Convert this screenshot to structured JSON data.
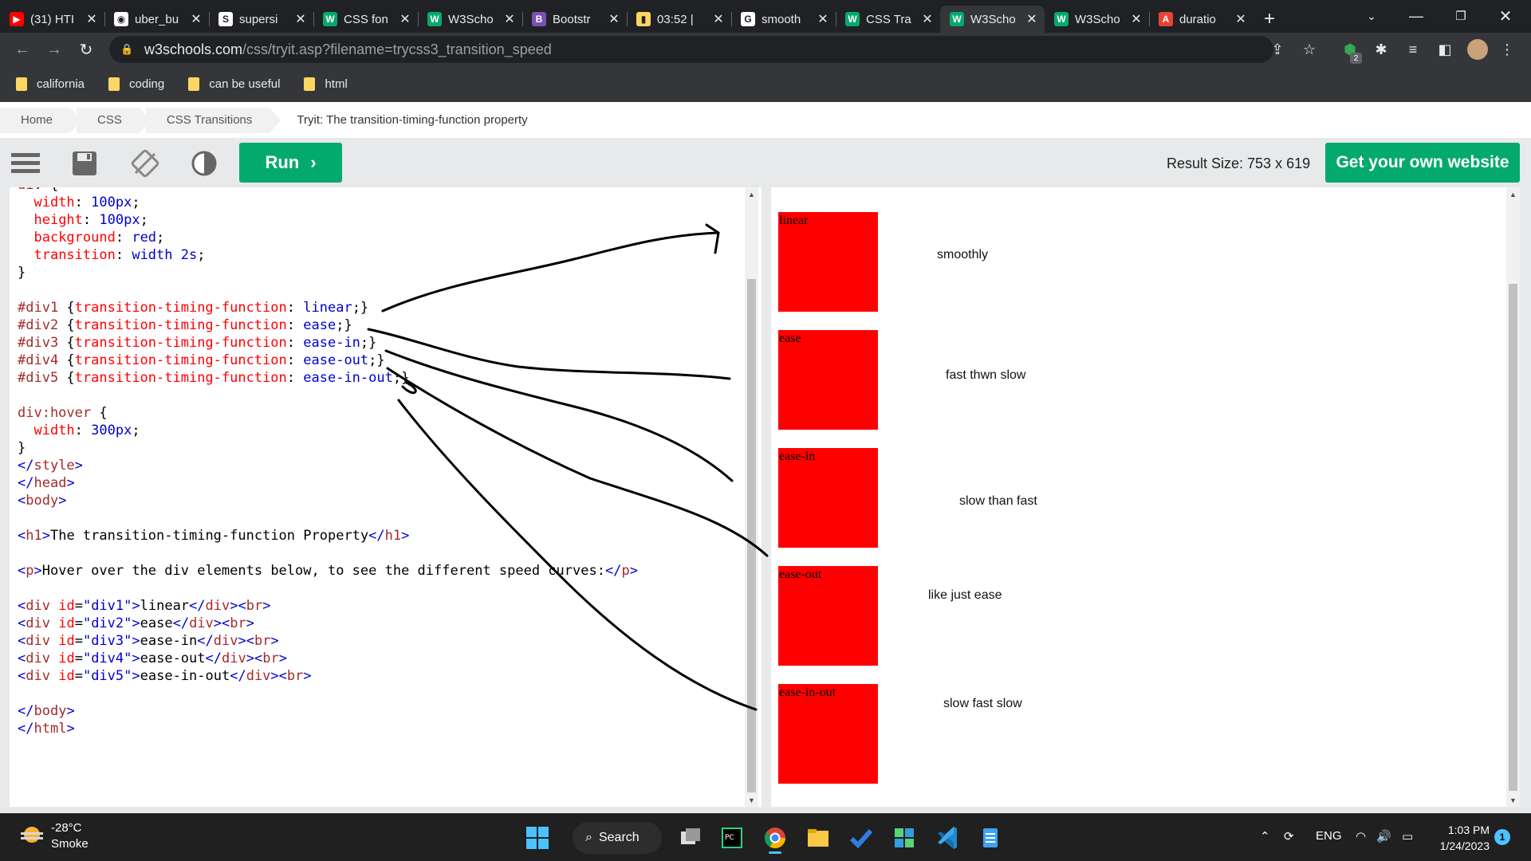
{
  "tabs": [
    {
      "title": "(31) HTI",
      "icon": "youtube-icon",
      "color": "#ff0000",
      "glyph": "▶"
    },
    {
      "title": "uber_bu",
      "icon": "github-icon",
      "color": "#ffffff",
      "glyph": "◉"
    },
    {
      "title": "supersi",
      "icon": "s-icon",
      "color": "#ffffff",
      "glyph": "S"
    },
    {
      "title": "CSS fon",
      "icon": "w3schools-icon",
      "color": "#04aa6d",
      "glyph": "W"
    },
    {
      "title": "W3Scho",
      "icon": "w3schools-icon",
      "color": "#04aa6d",
      "glyph": "W"
    },
    {
      "title": "Bootstr",
      "icon": "bootstrap-icon",
      "color": "#7952b3",
      "glyph": "B"
    },
    {
      "title": "03:52 |",
      "icon": "note-icon",
      "color": "#fcd663",
      "glyph": "▮"
    },
    {
      "title": "smooth",
      "icon": "google-icon",
      "color": "#ffffff",
      "glyph": "G"
    },
    {
      "title": "CSS Tra",
      "icon": "w3schools-icon",
      "color": "#04aa6d",
      "glyph": "W"
    },
    {
      "title": "W3Scho",
      "icon": "w3schools-icon",
      "color": "#04aa6d",
      "glyph": "W"
    },
    {
      "title": "W3Scho",
      "icon": "w3schools-icon",
      "color": "#04aa6d",
      "glyph": "W"
    },
    {
      "title": "duratio",
      "icon": "translate-icon",
      "color": "#ea4335",
      "glyph": "A"
    }
  ],
  "active_tab_index": 9,
  "address": {
    "host": "w3schools.com",
    "path": "/css/tryit.asp?filename=trycss3_transition_speed"
  },
  "extensions_badge": "2",
  "bookmarks": [
    "california",
    "coding",
    "can be useful",
    "html"
  ],
  "breadcrumb": [
    "Home",
    "CSS",
    "CSS Transitions",
    "Tryit: The transition-timing-function property"
  ],
  "toolbar": {
    "run_label": "Run",
    "result_size": "Result Size: 753 x 619",
    "get_website_label": "Get your own website"
  },
  "code_lines": [
    "div {",
    "  width: 100px;",
    "  height: 100px;",
    "  background: red;",
    "  transition: width 2s;",
    "}",
    "",
    "#div1 {transition-timing-function: linear;}",
    "#div2 {transition-timing-function: ease;}",
    "#div3 {transition-timing-function: ease-in;}",
    "#div4 {transition-timing-function: ease-out;}",
    "#div5 {transition-timing-function: ease-in-out;}",
    "",
    "div:hover {",
    "  width: 300px;",
    "}",
    "</style>",
    "</head>",
    "<body>",
    "",
    "<h1>The transition-timing-function Property</h1>",
    "",
    "<p>Hover over the div elements below, to see the different speed curves:</p>",
    "",
    "<div id=\"div1\">linear</div><br>",
    "<div id=\"div2\">ease</div><br>",
    "<div id=\"div3\">ease-in</div><br>",
    "<div id=\"div4\">ease-out</div><br>",
    "<div id=\"div5\">ease-in-out</div><br>",
    "",
    "</body>",
    "</html>"
  ],
  "result_boxes": [
    "linear",
    "ease",
    "ease-in",
    "ease-out",
    "ease-in-out"
  ],
  "notes": [
    "smoothly",
    "fast thwn slow",
    "slow than fast",
    "like just ease",
    "slow fast slow"
  ],
  "taskbar": {
    "temperature": "-28°C",
    "condition": "Smoke",
    "search_label": "Search",
    "language": "ENG",
    "time": "1:03 PM",
    "date": "1/24/2023",
    "notification_count": "1"
  }
}
